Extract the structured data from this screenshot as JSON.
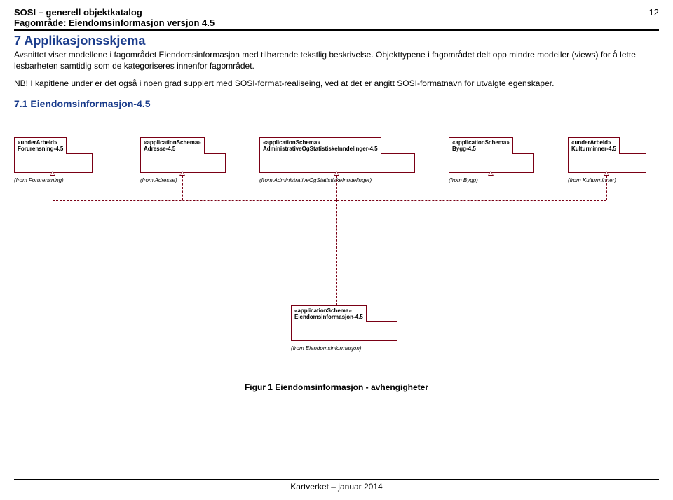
{
  "header": {
    "doc_title": "SOSI – generell objektkatalog",
    "subject": "Fagområde: Eiendomsinformasjon  versjon 4.5",
    "page_number": "12"
  },
  "section": {
    "h1": "7 Applikasjonsskjema",
    "para1": "Avsnittet viser modellene i fagområdet Eiendomsinformasjon med tilhørende tekstlig beskrivelse. Objekttypene i fagområdet delt opp mindre modeller (views) for å lette lesbarheten samtidig som de kategoriseres innenfor fagområdet.",
    "para2": "NB! I kapitlene under er det også i noen grad supplert med SOSI-format-realiseing, ved at det er angitt SOSI-formatnavn for utvalgte egenskaper.",
    "h2": "7.1 Eiendomsinformasjon-4.5"
  },
  "packages": {
    "p1": {
      "stereo": "«underArbeid»",
      "name": "Forurensning-4.5",
      "from": "(from Forurensning)"
    },
    "p2": {
      "stereo": "«applicationSchema»",
      "name": "Adresse-4.5",
      "from": "(from Adresse)"
    },
    "p3": {
      "stereo": "«applicationSchema»",
      "name": "AdministrativeOgStatistiskeInndelinger-4.5",
      "from": "(from AdministrativeOgStatistiskeInndelinger)"
    },
    "p4": {
      "stereo": "«applicationSchema»",
      "name": "Bygg-4.5",
      "from": "(from Bygg)"
    },
    "p5": {
      "stereo": "«underArbeid»",
      "name": "Kulturminner-4.5",
      "from": "(from Kulturminner)"
    },
    "p6": {
      "stereo": "«applicationSchema»",
      "name": "Eiendomsinformasjon-4.5",
      "from": "(from Eiendomsinformasjon)"
    }
  },
  "figure_caption": "Figur 1 Eiendomsinformasjon - avhengigheter",
  "footer": "Kartverket – januar 2014"
}
